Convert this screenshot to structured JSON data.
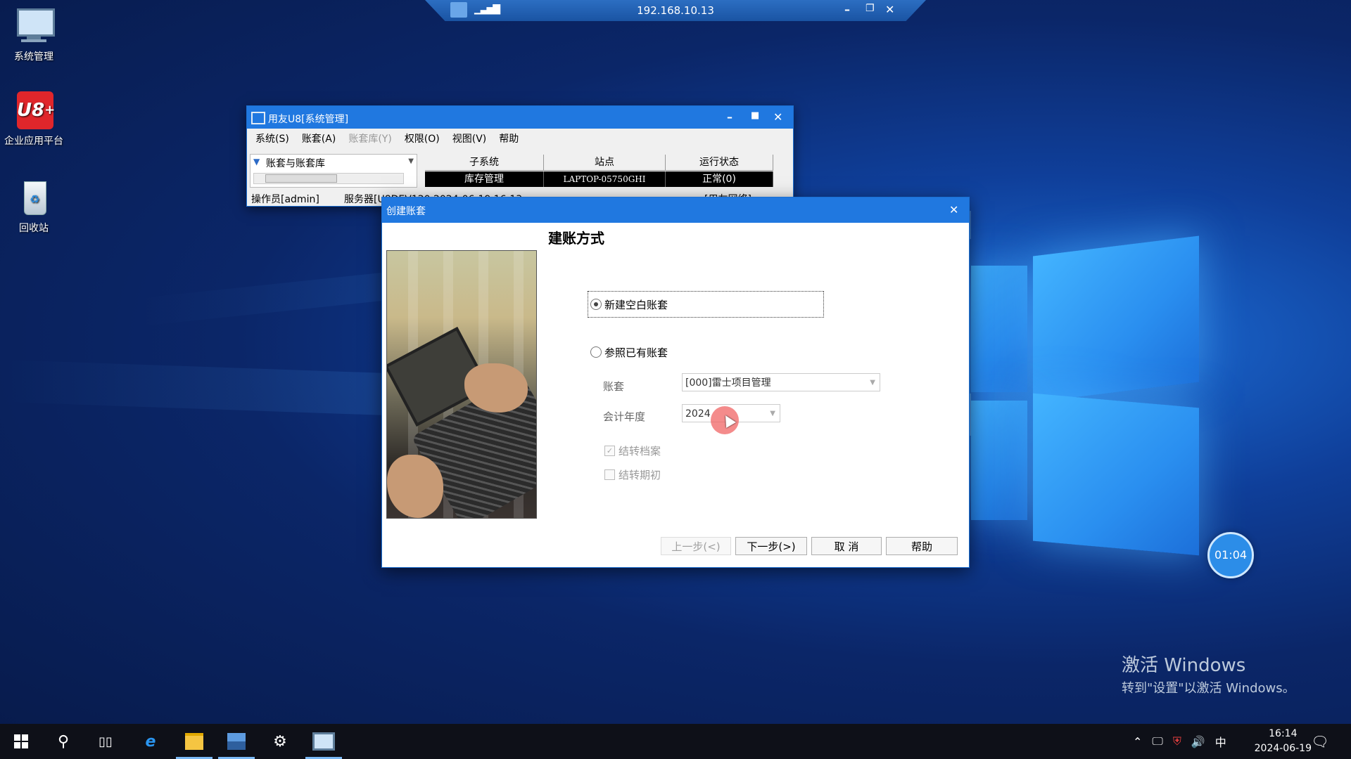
{
  "rdp_bar": {
    "ip": "192.168.10.13",
    "minimize_icon": "minimize-icon",
    "restore_icon": "restore-icon",
    "close_icon": "close-icon"
  },
  "desktop_icons": [
    {
      "label": "系统管理",
      "icon": "computer-icon"
    },
    {
      "label": "企业应用平台",
      "icon": "u8-plus-icon"
    },
    {
      "label": "回收站",
      "icon": "recycle-bin-icon"
    }
  ],
  "main_window": {
    "title": "用友U8[系统管理]",
    "menu": [
      {
        "label": "系统(S)",
        "enabled": true
      },
      {
        "label": "账套(A)",
        "enabled": true
      },
      {
        "label": "账套库(Y)",
        "enabled": false
      },
      {
        "label": "权限(O)",
        "enabled": true
      },
      {
        "label": "视图(V)",
        "enabled": true
      },
      {
        "label": "帮助",
        "enabled": true
      }
    ],
    "tree_root": "账套与账套库",
    "table_headers": [
      "子系统",
      "站点",
      "运行状态"
    ],
    "table_rows": [
      [
        "库存管理",
        "LAPTOP-05750GHI",
        "正常(0)"
      ]
    ],
    "status_operator": "操作员[admin]",
    "status_server": "服务器[U8DEV120   2024-06-19 16:13",
    "status_right": "[用友网络]"
  },
  "dialog": {
    "title": "创建账套",
    "heading": "建账方式",
    "option_new": "新建空白账套",
    "option_ref": "参照已有账套",
    "account_label": "账套",
    "account_value": "[000]雷士项目管理",
    "year_label": "会计年度",
    "year_value": "2024",
    "check_archive": "结转档案",
    "check_period": "结转期初",
    "btn_prev": "上一步(<)",
    "btn_next": "下一步(>)",
    "btn_cancel": "取 消",
    "btn_help": "帮助"
  },
  "timer": "01:04",
  "watermark": {
    "line1": "激活 Windows",
    "line2": "转到\"设置\"以激活 Windows。"
  },
  "taskbar": {
    "ime": "中",
    "time": "16:14",
    "date": "2024-06-19"
  }
}
